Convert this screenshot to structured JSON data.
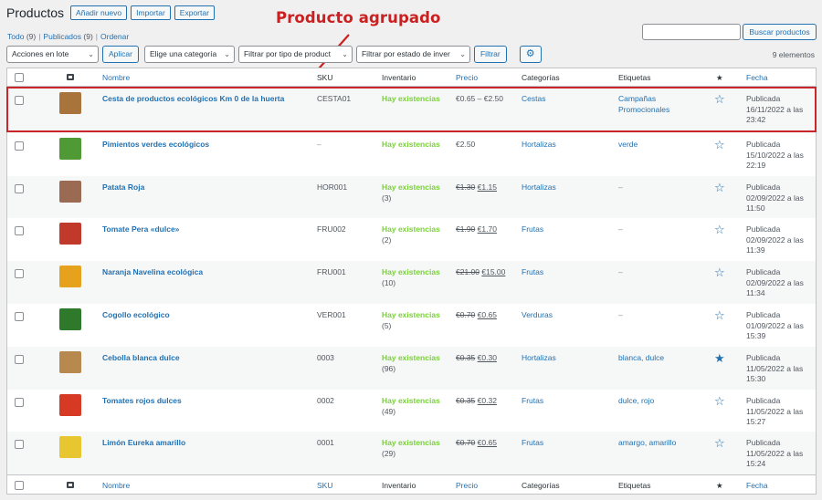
{
  "header": {
    "title": "Productos",
    "buttons": [
      "Añadir nuevo",
      "Importar",
      "Exportar"
    ]
  },
  "annotation": "Producto agrupado",
  "views": {
    "all_label": "Todo",
    "all_count": "(9)",
    "published_label": "Publicados",
    "published_count": "(9)",
    "sort_label": "Ordenar"
  },
  "search": {
    "button": "Buscar productos"
  },
  "tablenav": {
    "bulk_select": "Acciones en lote",
    "apply": "Aplicar",
    "category_select": "Elige una categoría",
    "type_select": "Filtrar por tipo de product",
    "stock_select": "Filtrar por estado de inver",
    "filter": "Filtrar",
    "items_count": "9 elementos"
  },
  "columns": {
    "name": "Nombre",
    "sku": "SKU",
    "inventory": "Inventario",
    "price": "Precio",
    "categories": "Categorías",
    "tags": "Etiquetas",
    "featured": "★",
    "date": "Fecha"
  },
  "colors": {
    "accent": "#2271b1",
    "in_stock": "#7ad03a",
    "highlight": "#c9252b"
  },
  "products": [
    {
      "name": "Cesta de productos ecológicos Km 0 de la huerta",
      "sku": "CESTA01",
      "stock": "Hay existencias",
      "qty": "",
      "price_old": "",
      "price": "€0.65 – €2.50",
      "category": "Cestas",
      "tags": "Campañas Promocionales",
      "featured": false,
      "date_status": "Publicada",
      "date": "16/11/2022 a las 23:42",
      "thumb_color": "#a8743c"
    },
    {
      "name": "Pimientos verdes ecológicos",
      "sku": "–",
      "stock": "Hay existencias",
      "qty": "",
      "price_old": "",
      "price": "€2.50",
      "category": "Hortalizas",
      "tags": "verde",
      "featured": false,
      "date_status": "Publicada",
      "date": "15/10/2022 a las 22:19",
      "thumb_color": "#4f9a35"
    },
    {
      "name": "Patata Roja",
      "sku": "HOR001",
      "stock": "Hay existencias",
      "qty": "(3)",
      "price_old": "€1.30",
      "price": "€1.15",
      "category": "Hortalizas",
      "tags": "–",
      "featured": false,
      "date_status": "Publicada",
      "date": "02/09/2022 a las 11:50",
      "thumb_color": "#9b6a52"
    },
    {
      "name": "Tomate Pera «dulce»",
      "sku": "FRU002",
      "stock": "Hay existencias",
      "qty": "(2)",
      "price_old": "€1.90",
      "price": "€1.70",
      "category": "Frutas",
      "tags": "–",
      "featured": false,
      "date_status": "Publicada",
      "date": "02/09/2022 a las 11:39",
      "thumb_color": "#c0392b"
    },
    {
      "name": "Naranja Navelina ecológica",
      "sku": "FRU001",
      "stock": "Hay existencias",
      "qty": "(10)",
      "price_old": "€21.00",
      "price": "€15.00",
      "category": "Frutas",
      "tags": "–",
      "featured": false,
      "date_status": "Publicada",
      "date": "02/09/2022 a las 11:34",
      "thumb_color": "#e6a21c"
    },
    {
      "name": "Cogollo ecológico",
      "sku": "VER001",
      "stock": "Hay existencias",
      "qty": "(5)",
      "price_old": "€0.70",
      "price": "€0.65",
      "category": "Verduras",
      "tags": "–",
      "featured": false,
      "date_status": "Publicada",
      "date": "01/09/2022 a las 15:39",
      "thumb_color": "#2f7a2a"
    },
    {
      "name": "Cebolla blanca dulce",
      "sku": "0003",
      "stock": "Hay existencias",
      "qty": "(96)",
      "price_old": "€0.35",
      "price": "€0.30",
      "category": "Hortalizas",
      "tags": "blanca, dulce",
      "featured": true,
      "date_status": "Publicada",
      "date": "11/05/2022 a las 15:30",
      "thumb_color": "#b8894f"
    },
    {
      "name": "Tomates rojos dulces",
      "sku": "0002",
      "stock": "Hay existencias",
      "qty": "(49)",
      "price_old": "€0.35",
      "price": "€0.32",
      "category": "Frutas",
      "tags": "dulce, rojo",
      "featured": false,
      "date_status": "Publicada",
      "date": "11/05/2022 a las 15:27",
      "thumb_color": "#d63a25"
    },
    {
      "name": "Limón Eureka amarillo",
      "sku": "0001",
      "stock": "Hay existencias",
      "qty": "(29)",
      "price_old": "€0.70",
      "price": "€0.65",
      "category": "Frutas",
      "tags": "amargo, amarillo",
      "featured": false,
      "date_status": "Publicada",
      "date": "11/05/2022 a las 15:24",
      "thumb_color": "#e8c630"
    }
  ]
}
